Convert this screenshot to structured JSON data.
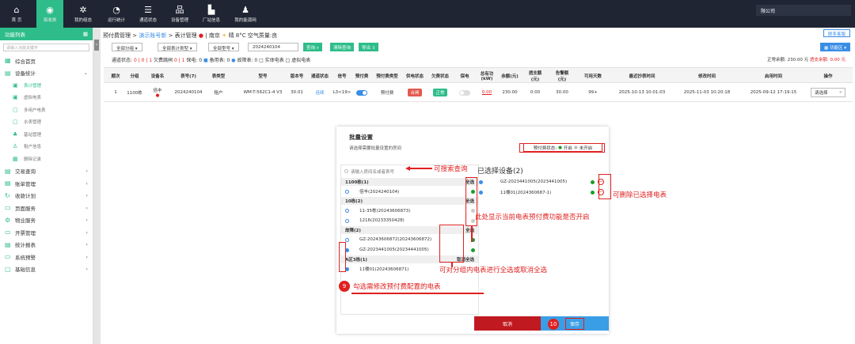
{
  "topnav": {
    "items": [
      {
        "label": "首 页",
        "icon": "home-icon"
      },
      {
        "label": "易收费",
        "icon": "billing-icon"
      },
      {
        "label": "我的组态",
        "icon": "config-icon"
      },
      {
        "label": "运行统计",
        "icon": "stats-icon"
      },
      {
        "label": "通道状态",
        "icon": "channel-icon"
      },
      {
        "label": "设备管理",
        "icon": "device-icon"
      },
      {
        "label": "厂站信息",
        "icon": "station-icon"
      },
      {
        "label": "我的能源网",
        "icon": "user-icon"
      }
    ],
    "company": "限公司"
  },
  "sidebar": {
    "title": "功能列表",
    "search_placeholder": "请输入功能关键字",
    "items": [
      {
        "label": "综合首页"
      },
      {
        "label": "设备统计"
      },
      {
        "label": "表计管理"
      },
      {
        "label": "虚拟电表"
      },
      {
        "label": "多用户电表"
      },
      {
        "label": "水表管理"
      },
      {
        "label": "基站管理"
      },
      {
        "label": "租户信息"
      },
      {
        "label": "删除记录"
      },
      {
        "label": "交易查询"
      },
      {
        "label": "账单管理"
      },
      {
        "label": "收款计划"
      },
      {
        "label": "页面服务"
      },
      {
        "label": "物业服务"
      },
      {
        "label": "开票管理"
      },
      {
        "label": "统计报表"
      },
      {
        "label": "系统预警"
      },
      {
        "label": "基础信息"
      }
    ]
  },
  "header": {
    "crumb1": "预付费管理 >",
    "crumb2": "演示账号新",
    "crumb3": "> 表计管理",
    "location": "南京",
    "weather": "晴 8°C 空气质量:良",
    "feedback": "联系客服",
    "function_area": "功能区"
  },
  "filters": {
    "group": "全部分组",
    "meter_type": "全部表计类型",
    "model": "全部型号",
    "keyword": "2024240104",
    "query": "查询",
    "clear": "清除查询",
    "export": "导出"
  },
  "status": {
    "comm_label": "通道状态:",
    "comm_vals": "0 | 0 | 1",
    "fee_label": "欠费跳闸",
    "fee_vals": "0 | 1",
    "protect": "保电: 0",
    "standby": "备用表: 0",
    "fault": "故障表: 0",
    "real_meter": "实体电表",
    "virtual_meter": "虚拟电表",
    "normal_balance": "正常余额: 230.00 元",
    "overdraft": "透支余额: 0.00 元"
  },
  "table": {
    "headers": [
      "顺次",
      "分组",
      "设备名",
      "表号(7)",
      "表类型",
      "型号",
      "版本号",
      "通道状态",
      "信号",
      "预付费",
      "预付费类型",
      "供电状态",
      "欠费状态",
      "保电",
      "总有功(kW)",
      "余额(元)",
      "透支额(元)",
      "告警额(元)",
      "可用天数",
      "最近抄表时间",
      "修改时间",
      "启用时间",
      "操作"
    ],
    "row": {
      "idx": "1",
      "group": "1100栋",
      "device": "倍丰",
      "meter_no": "2024240104",
      "meter_type": "租户",
      "model": "WM-T-562C1-4 V3",
      "version": "30.01",
      "channel": "连续",
      "signal": "L3<19>",
      "prepay_type": "预付费",
      "power_state": "合闸",
      "fee_state": "正常",
      "total_kw": "0.00",
      "balance": "230.00",
      "overdraft": "0.00",
      "alarm": "30.00",
      "days": "99+",
      "last_read": "2025-10-13 10:01:03",
      "modified": "2025-11-03 10:20:18",
      "enabled": "2025-09-12 17:19:15",
      "action": "请选择"
    }
  },
  "modal": {
    "title": "批量设置",
    "subtitle": "请选择需要批量设置的房间",
    "legend_label": "预付费状态:",
    "legend_on": "开启",
    "legend_off": "未开启",
    "search_placeholder": "请输入房间名或者表号",
    "groups": [
      {
        "name": "1100栋(1)",
        "action": "全选"
      },
      {
        "name": "10栋(2)",
        "action": "全选"
      },
      {
        "name": "故障(2)",
        "action": "全选"
      },
      {
        "name": "A区3栋(1)",
        "action": "取消全选"
      }
    ],
    "items": [
      {
        "label": "倍丰(2024240104)"
      },
      {
        "label": "11-35栋(20243606873)"
      },
      {
        "label": "1216(20233350428)"
      },
      {
        "label": "GZ-20243606872(20243606872)"
      },
      {
        "label": "GZ-2023441005(20234441005)"
      },
      {
        "label": "11楼01(20243606871)"
      }
    ],
    "selected_title": "已选择设备(2)",
    "selected": [
      {
        "label": "GZ-2023441005(2023441005)"
      },
      {
        "label": "11楼01(2024360687-1)"
      }
    ],
    "cancel": "取消",
    "save": "保存"
  },
  "annotations": {
    "search_hint": "可搜索查询",
    "delete_hint": "可删除已选择电表",
    "status_hint": "此处显示当前电表预付费功能是否开启",
    "group_hint": "可对分组内电表进行全选或取消全选",
    "step9_num": "9",
    "step9": "勾选需修改预付费配置的电表",
    "step10_num": "10"
  }
}
